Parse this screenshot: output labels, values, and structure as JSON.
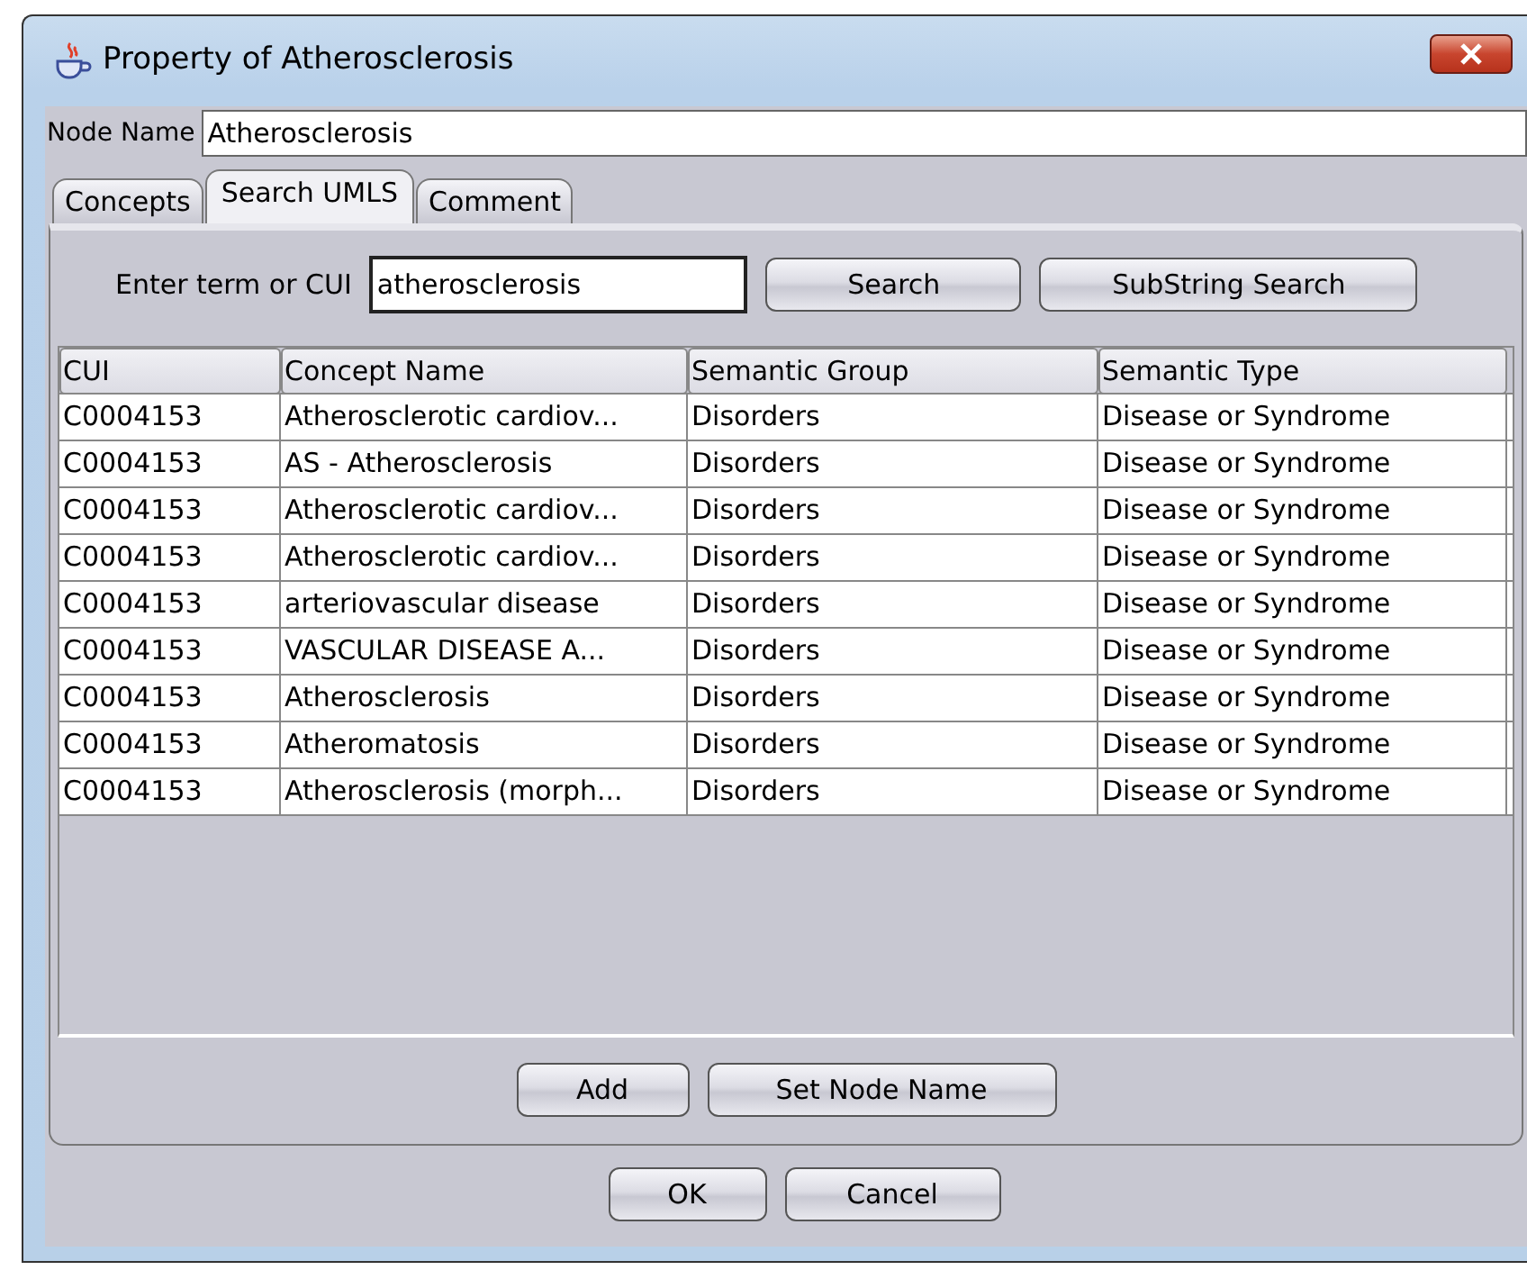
{
  "window": {
    "title": "Property of Atherosclerosis"
  },
  "node_name": {
    "label": "Node Name",
    "value": "Atherosclerosis"
  },
  "tabs": [
    {
      "label": "Concepts",
      "selected": false
    },
    {
      "label": "Search UMLS",
      "selected": true
    },
    {
      "label": "Comment",
      "selected": false
    }
  ],
  "search": {
    "label": "Enter term or CUI",
    "value": "atherosclerosis",
    "buttons": [
      "Search",
      "SubString Search"
    ]
  },
  "table": {
    "columns": [
      "CUI",
      "Concept Name",
      "Semantic Group",
      "Semantic Type"
    ],
    "rows": [
      [
        "C0004153",
        "Atherosclerotic cardiov...",
        "Disorders",
        "Disease or Syndrome"
      ],
      [
        "C0004153",
        "AS - Atherosclerosis",
        "Disorders",
        "Disease or Syndrome"
      ],
      [
        "C0004153",
        "Atherosclerotic cardiov...",
        "Disorders",
        "Disease or Syndrome"
      ],
      [
        "C0004153",
        "Atherosclerotic cardiov...",
        "Disorders",
        "Disease or Syndrome"
      ],
      [
        "C0004153",
        "arteriovascular disease",
        "Disorders",
        "Disease or Syndrome"
      ],
      [
        "C0004153",
        "VASCULAR DISEASE A...",
        "Disorders",
        "Disease or Syndrome"
      ],
      [
        "C0004153",
        "Atherosclerosis",
        "Disorders",
        "Disease or Syndrome"
      ],
      [
        "C0004153",
        "Atheromatosis",
        "Disorders",
        "Disease or Syndrome"
      ],
      [
        "C0004153",
        "Atherosclerosis (morph...",
        "Disorders",
        "Disease or Syndrome"
      ]
    ]
  },
  "panel_buttons": [
    "Add",
    "Set Node Name"
  ],
  "dialog_buttons": [
    "OK",
    "Cancel"
  ]
}
